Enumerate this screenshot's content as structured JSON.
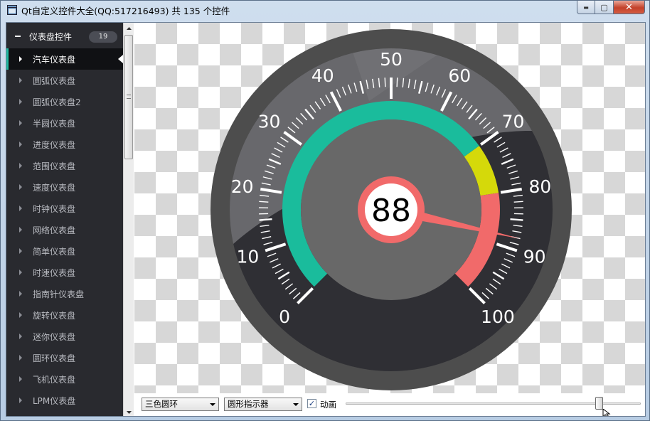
{
  "window": {
    "title": "Qt自定义控件大全(QQ:517216493) 共 135 个控件",
    "minimize_glyph": "▬",
    "maximize_glyph": "▢",
    "close_glyph": "✕"
  },
  "nav": {
    "parent": {
      "label": "仪表盘控件",
      "count": "19"
    },
    "items": [
      {
        "label": "汽车仪表盘",
        "active": true
      },
      {
        "label": "圆弧仪表盘"
      },
      {
        "label": "圆弧仪表盘2"
      },
      {
        "label": "半圆仪表盘"
      },
      {
        "label": "进度仪表盘"
      },
      {
        "label": "范围仪表盘"
      },
      {
        "label": "速度仪表盘"
      },
      {
        "label": "时钟仪表盘"
      },
      {
        "label": "网络仪表盘"
      },
      {
        "label": "简单仪表盘"
      },
      {
        "label": "时速仪表盘"
      },
      {
        "label": "指南针仪表盘"
      },
      {
        "label": "旋转仪表盘"
      },
      {
        "label": "迷你仪表盘"
      },
      {
        "label": "圆环仪表盘"
      },
      {
        "label": "飞机仪表盘"
      },
      {
        "label": "LPM仪表盘"
      }
    ]
  },
  "gauge": {
    "value": "88",
    "min": 0,
    "max": 100,
    "scale_labels": [
      "0",
      "10",
      "20",
      "30",
      "40",
      "50",
      "60",
      "70",
      "80",
      "90",
      "100"
    ],
    "ring_colors": {
      "start": "#1abc9c",
      "mid": "#d5d90a",
      "end": "#f16a6a"
    },
    "ring_stops": [
      0,
      70,
      80,
      100
    ]
  },
  "toolbar": {
    "ring_style": "三色圆环",
    "pointer_style": "圆形指示器",
    "animation_label": "动画",
    "animation_checked": true,
    "check_glyph": "✓"
  },
  "slider": {
    "value": 88,
    "min": 0,
    "max": 100
  }
}
